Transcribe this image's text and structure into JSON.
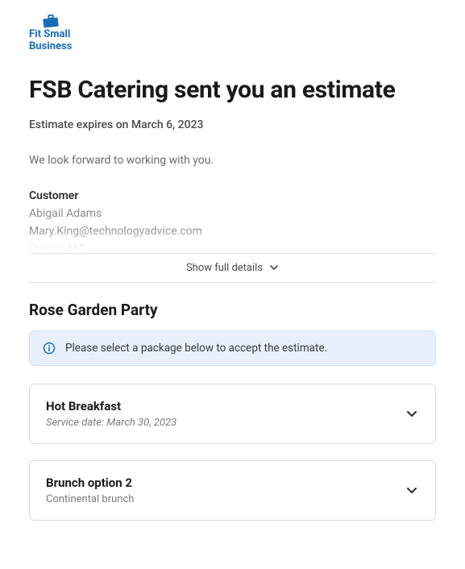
{
  "logo": {
    "line1": "Fit Small",
    "line2": "Business"
  },
  "page_title": "FSB Catering sent you an estimate",
  "expires_line": "Estimate expires on March 6, 2023",
  "intro_text": "We look forward to working with you.",
  "customer": {
    "heading": "Customer",
    "name": "Abigail Adams",
    "email": "Mary.King@technologyadvice.com",
    "location": "Quincy, MA"
  },
  "show_details_label": "Show full details",
  "section_title": "Rose Garden Party",
  "banner_text": "Please select a package below to accept the estimate.",
  "packages": [
    {
      "title": "Hot Breakfast",
      "subtitle": "Service date: March 30, 2023",
      "subtitle_italic": true
    },
    {
      "title": "Brunch option 2",
      "subtitle": "Continental brunch",
      "subtitle_italic": false
    }
  ]
}
